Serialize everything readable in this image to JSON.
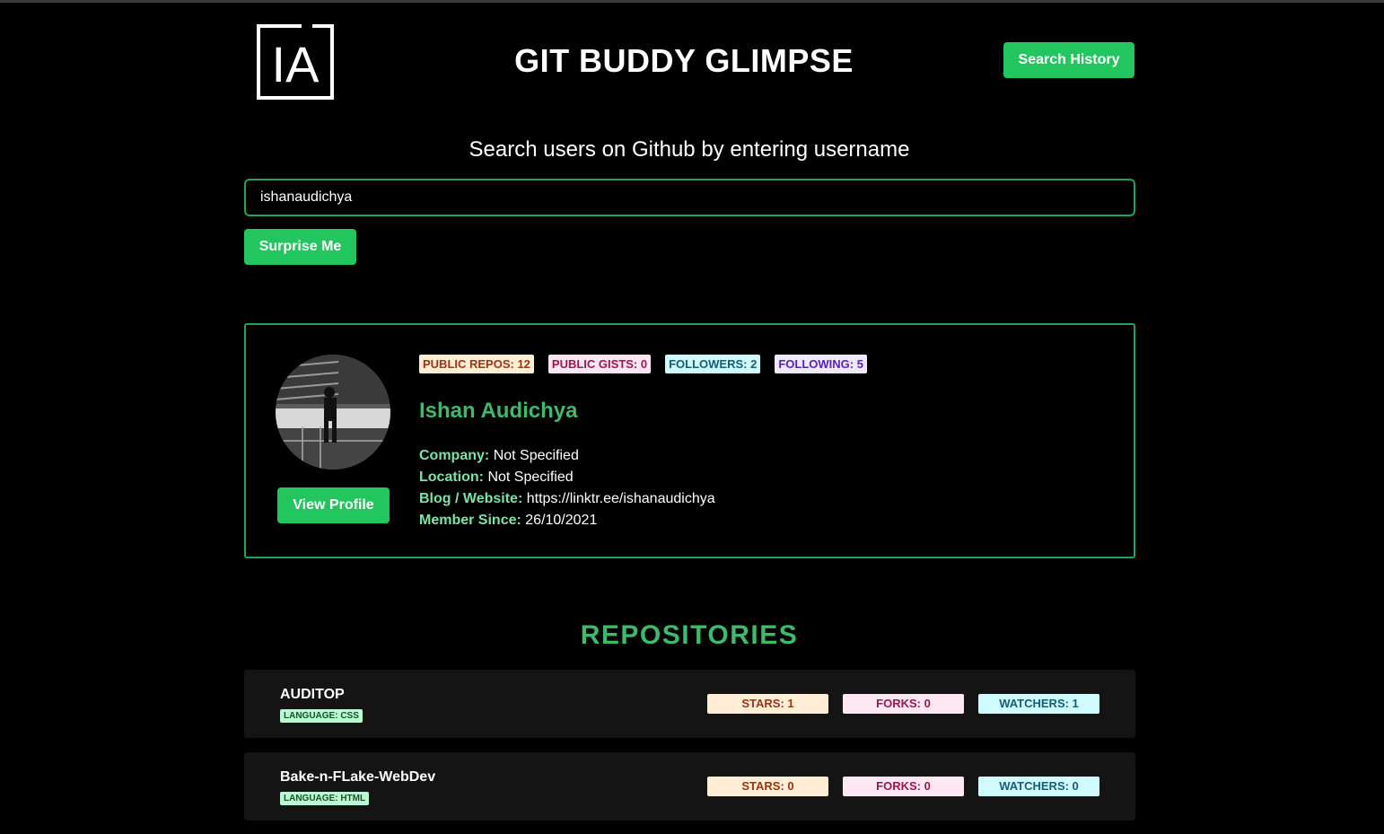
{
  "header": {
    "logo_text": "IA",
    "title": "GIT BUDDY GLIMPSE",
    "history_button": "Search History"
  },
  "search": {
    "prompt": "Search users on Github by entering username",
    "value": "ishanaudichya",
    "surprise_button": "Surprise Me"
  },
  "profile": {
    "badges": {
      "public_repos": "PUBLIC REPOS: 12",
      "public_gists": "PUBLIC GISTS: 0",
      "followers": "FOLLOWERS: 2",
      "following": "FOLLOWING: 5"
    },
    "name": "Ishan Audichya",
    "company_label": "Company:",
    "company": "Not Specified",
    "location_label": "Location:",
    "location": "Not Specified",
    "blog_label": "Blog / Website:",
    "blog": "https://linktr.ee/ishanaudichya",
    "member_label": "Member Since:",
    "member_since": "26/10/2021",
    "view_button": "View Profile"
  },
  "repositories": {
    "heading": "REPOSITORIES",
    "items": [
      {
        "name": "AUDITOP",
        "language": "LANGUAGE: CSS",
        "stars": "STARS: 1",
        "forks": "FORKS: 0",
        "watchers": "WATCHERS: 1"
      },
      {
        "name": "Bake-n-FLake-WebDev",
        "language": "LANGUAGE: HTML",
        "stars": "STARS: 0",
        "forks": "FORKS: 0",
        "watchers": "WATCHERS: 0"
      }
    ]
  },
  "colors": {
    "accent": "#22c55e",
    "accent_text": "#3dba6c",
    "border": "#22a35a",
    "background": "#000000",
    "card": "#141414"
  }
}
